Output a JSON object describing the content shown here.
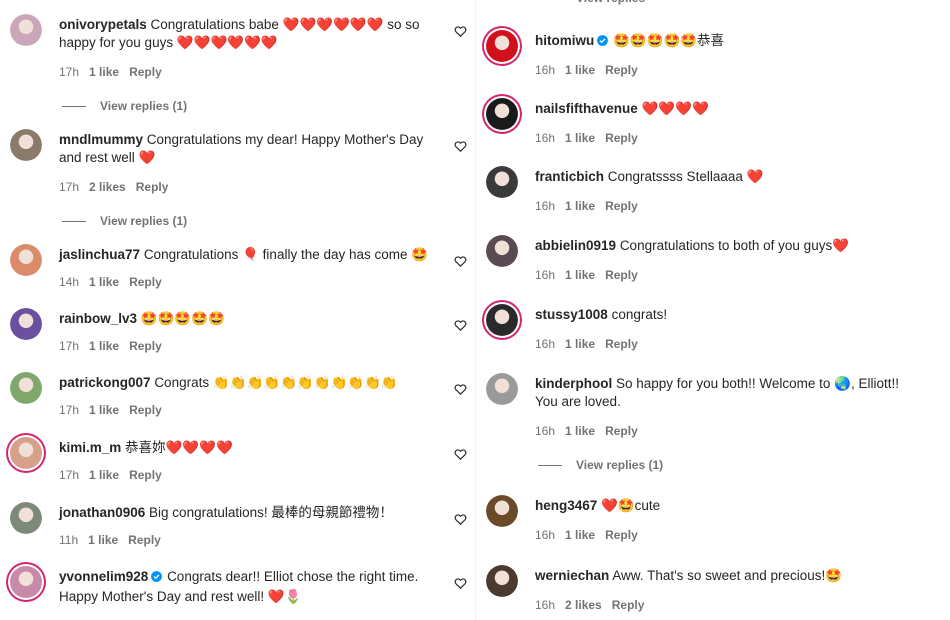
{
  "left": [
    {
      "user": "onivorypetals",
      "verified": false,
      "text": "Congratulations babe ❤️❤️❤️❤️❤️❤️ so so happy for you guys ❤️❤️❤️❤️❤️❤️",
      "time": "17h",
      "likes": "1 like",
      "reply": "Reply",
      "replies": "View replies (1)",
      "avatar": "#c9a7b8"
    },
    {
      "user": "mndlmummy",
      "verified": false,
      "text": "Congratulations my dear! Happy Mother's Day and rest well ❤️",
      "time": "17h",
      "likes": "2 likes",
      "reply": "Reply",
      "replies": "View replies (1)",
      "avatar": "#8a7a6a"
    },
    {
      "user": "jaslinchua77",
      "verified": false,
      "text": "Congratulations 🎈 finally the day has come 🤩",
      "time": "14h",
      "likes": "1 like",
      "reply": "Reply",
      "replies": "",
      "avatar": "#d98b6a"
    },
    {
      "user": "rainbow_lv3",
      "verified": false,
      "text": "🤩🤩🤩🤩🤩",
      "time": "17h",
      "likes": "1 like",
      "reply": "Reply",
      "replies": "",
      "avatar": "#6b4fa0"
    },
    {
      "user": "patrickong007",
      "verified": false,
      "text": "Congrats 👏👏👏👏👏👏👏👏👏👏👏",
      "time": "17h",
      "likes": "1 like",
      "reply": "Reply",
      "replies": "",
      "avatar": "#7fa66b"
    },
    {
      "user": "kimi.m_m",
      "verified": false,
      "text": "恭喜妳❤️❤️❤️❤️",
      "time": "17h",
      "likes": "1 like",
      "reply": "Reply",
      "replies": "",
      "avatar": "#d6a08a"
    },
    {
      "user": "jonathan0906",
      "verified": false,
      "text": "Big congratulations! 最棒的母親節禮物！",
      "time": "11h",
      "likes": "1 like",
      "reply": "Reply",
      "replies": "",
      "avatar": "#7d8a7a"
    },
    {
      "user": "yvonnelim928",
      "verified": true,
      "text": "Congrats dear!! Elliot chose the right time. Happy Mother's Day and rest well! ❤️🌷",
      "time": "",
      "likes": "",
      "reply": "",
      "replies": "",
      "avatar": "#c78aa8"
    }
  ],
  "right": [
    {
      "user": "hitomiwu",
      "verified": true,
      "text": "🤩🤩🤩🤩🤩恭喜",
      "time": "16h",
      "likes": "1 like",
      "reply": "Reply",
      "replies": "",
      "avatar": "#d0101a"
    },
    {
      "user": "nailsfifthavenue",
      "verified": false,
      "text": "❤️❤️❤️❤️",
      "time": "16h",
      "likes": "1 like",
      "reply": "Reply",
      "replies": "",
      "avatar": "#1a1a1a"
    },
    {
      "user": "franticbich",
      "verified": false,
      "text": "Congratssss Stellaaaa ❤️",
      "time": "16h",
      "likes": "1 like",
      "reply": "Reply",
      "replies": "",
      "avatar": "#3a3a3a"
    },
    {
      "user": "abbielin0919",
      "verified": false,
      "text": "Congratulations to both of you guys❤️",
      "time": "16h",
      "likes": "1 like",
      "reply": "Reply",
      "replies": "",
      "avatar": "#5a4a52"
    },
    {
      "user": "stussy1008",
      "verified": false,
      "text": "congrats!",
      "time": "16h",
      "likes": "1 like",
      "reply": "Reply",
      "replies": "",
      "avatar": "#2a2a2a"
    },
    {
      "user": "kinderphool",
      "verified": false,
      "text": "So happy for you both!! Welcome to 🌏, Elliott!! You are loved.",
      "time": "16h",
      "likes": "1 like",
      "reply": "Reply",
      "replies": "View replies (1)",
      "avatar": "#9a9a9a"
    },
    {
      "user": "heng3467",
      "verified": false,
      "text": "❤️🤩cute",
      "time": "16h",
      "likes": "1 like",
      "reply": "Reply",
      "replies": "",
      "avatar": "#6b4a2a"
    },
    {
      "user": "werniechan",
      "verified": false,
      "text": "Aww. That's so sweet and precious!🤩",
      "time": "16h",
      "likes": "2 likes",
      "reply": "Reply",
      "replies": "",
      "avatar": "#4a3a30"
    }
  ],
  "top_cut_text": "View replies"
}
